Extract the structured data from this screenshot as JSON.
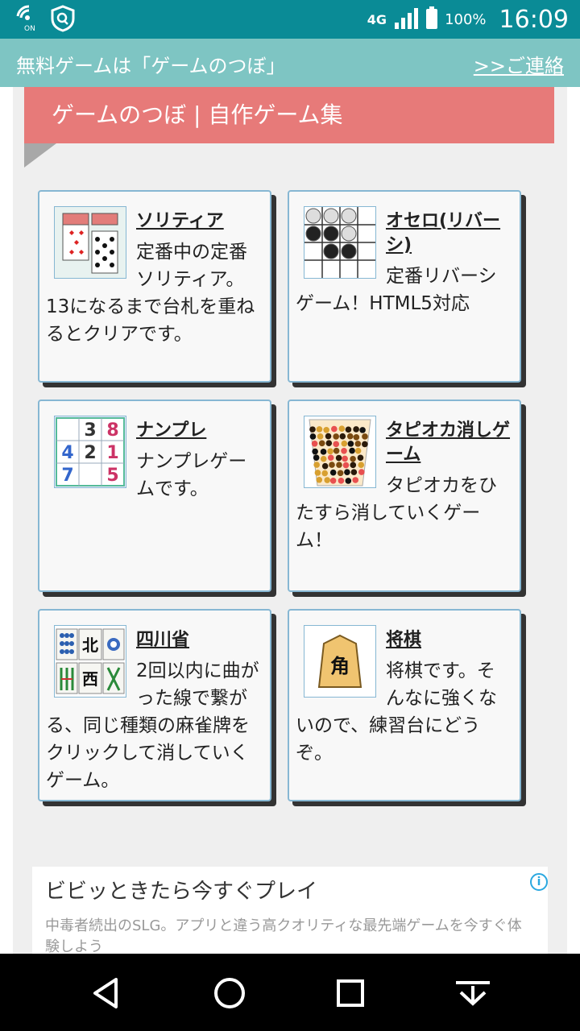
{
  "status_bar": {
    "network": "4G",
    "wifi_label": "ON",
    "battery": "100%",
    "time": "16:09"
  },
  "header": {
    "site_title": "無料ゲームは「ゲームのつぼ」",
    "contact_link": ">>ご連絡"
  },
  "section": {
    "title": "ゲームのつぼ | 自作ゲーム集"
  },
  "games": [
    {
      "title": "ソリティア",
      "description": "定番中の定番ソリティア。13になるまで台札を重ねるとクリアです。",
      "icon": "solitaire-thumbnail"
    },
    {
      "title": "オセロ(リバーシ)",
      "description": "定番リバーシゲーム！HTML5対応",
      "icon": "othello-thumbnail"
    },
    {
      "title": "ナンプレ",
      "description": "ナンプレゲームです。",
      "icon": "sudoku-thumbnail",
      "grid": [
        "",
        "3",
        "8",
        "4",
        "2",
        "1",
        "7",
        "",
        "5"
      ]
    },
    {
      "title": "タピオカ消しゲーム",
      "description": "タピオカをひたすら消していくゲーム！",
      "icon": "tapioca-thumbnail"
    },
    {
      "title": "四川省",
      "description": "2回以内に曲がった線で繋がる、同じ種類の麻雀牌をクリックして消していくゲーム。",
      "icon": "mahjong-thumbnail",
      "tiles": [
        "北",
        "西"
      ]
    },
    {
      "title": "将棋",
      "description": "将棋です。そんなに強くないので、練習台にどうぞ。",
      "icon": "shogi-thumbnail",
      "piece": "角"
    }
  ],
  "ad": {
    "title": "ビビッときたら今すぐプレイ",
    "description": "中毒者続出のSLG。アプリと違う高クオリティな最先端ゲームを今すぐ体験しよう",
    "info_symbol": "i"
  },
  "colors": {
    "status_bar": "#0a8b96",
    "header": "#7ec5c3",
    "ribbon": "#e77a79",
    "card_border": "#86b7d3"
  }
}
